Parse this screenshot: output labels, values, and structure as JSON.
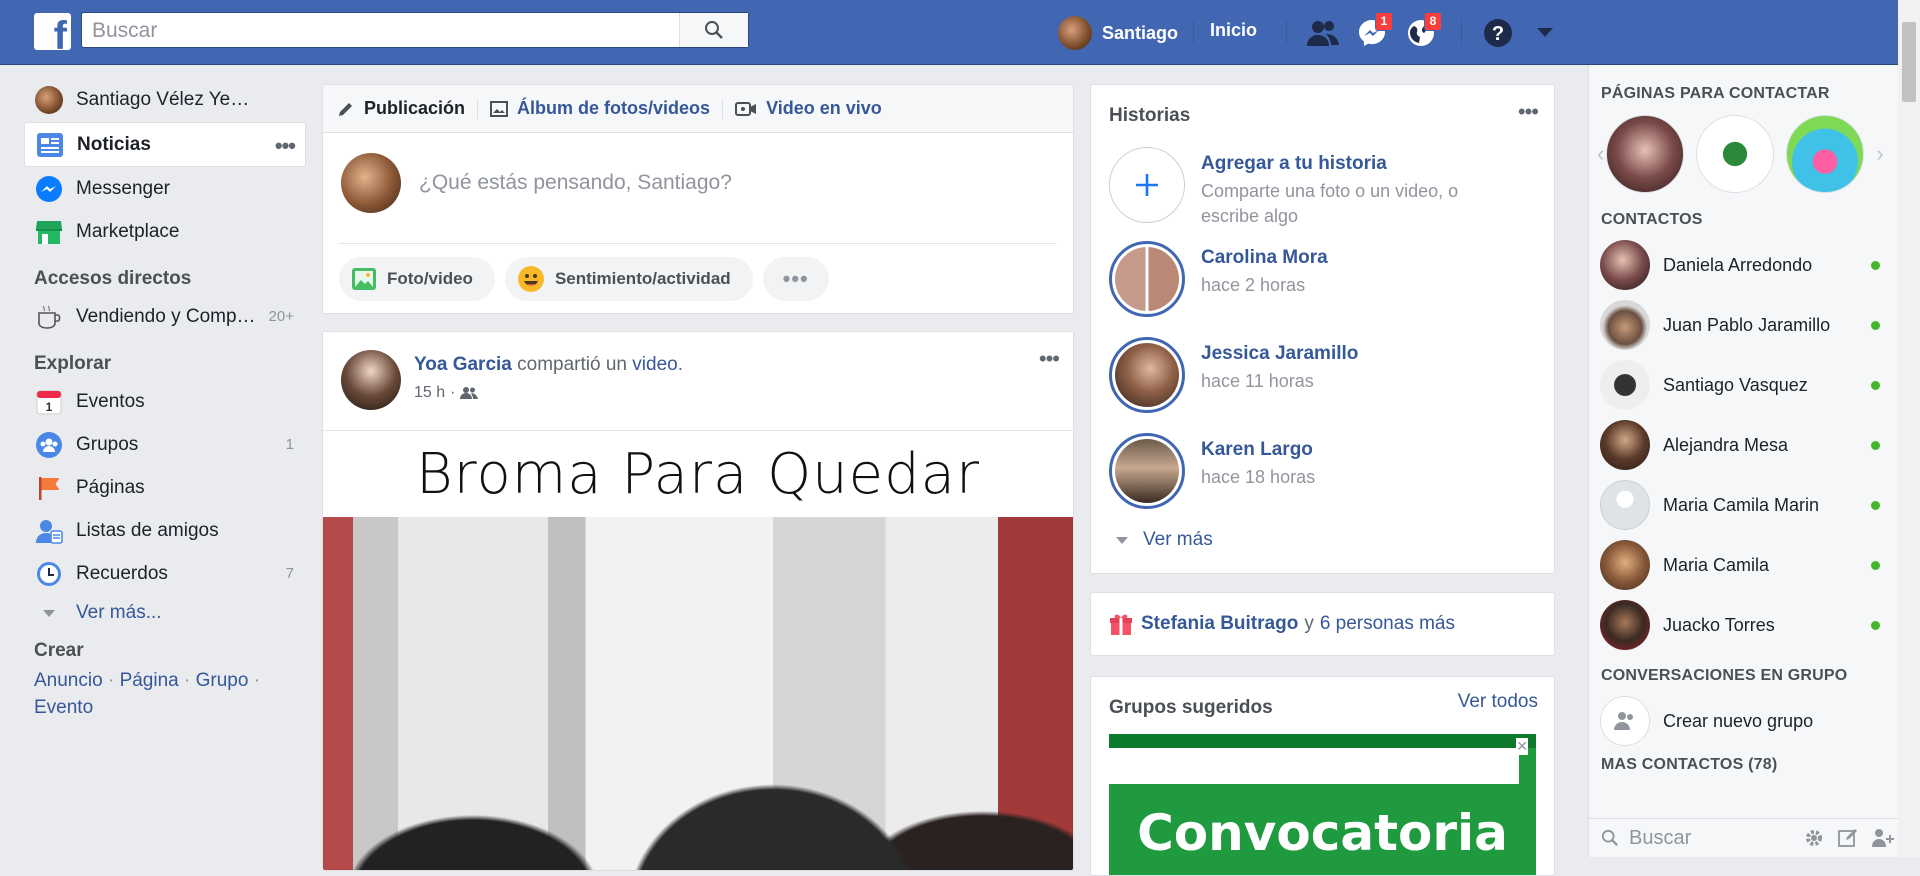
{
  "header": {
    "logo": "f",
    "search_placeholder": "Buscar",
    "user_name": "Santiago",
    "home_label": "Inicio",
    "messages_badge": "1",
    "notifications_badge": "8"
  },
  "left_nav": {
    "profile_name": "Santiago Vélez Ye…",
    "main_items": [
      {
        "label": "Noticias"
      },
      {
        "label": "Messenger"
      },
      {
        "label": "Marketplace"
      }
    ],
    "shortcuts_title": "Accesos directos",
    "shortcut": {
      "label": "Vendiendo y Comp…",
      "count": "20+"
    },
    "explore_title": "Explorar",
    "explore_items": [
      {
        "label": "Eventos",
        "count": ""
      },
      {
        "label": "Grupos",
        "count": "1"
      },
      {
        "label": "Páginas",
        "count": ""
      },
      {
        "label": "Listas de amigos",
        "count": ""
      },
      {
        "label": "Recuerdos",
        "count": "7"
      }
    ],
    "see_more": "Ver más...",
    "create_title": "Crear",
    "create_links": [
      "Anuncio",
      "Página",
      "Grupo",
      "Evento"
    ]
  },
  "composer": {
    "tabs": [
      "Publicación",
      "Álbum de fotos/videos",
      "Video en vivo"
    ],
    "placeholder": "¿Qué estás pensando, Santiago?",
    "actions": [
      "Foto/video",
      "Sentimiento/actividad"
    ]
  },
  "post": {
    "author": "Yoa Garcia",
    "action_pre": "compartió un",
    "action_link": "video",
    "time": "15 h",
    "video_title": "Broma Para Quedar"
  },
  "stories": {
    "title": "Historias",
    "add_title": "Agregar a tu historia",
    "add_sub": "Comparte una foto o un video, o escribe algo",
    "items": [
      {
        "name": "Carolina Mora",
        "time": "hace 2 horas"
      },
      {
        "name": "Jessica Jaramillo",
        "time": "hace 11 horas"
      },
      {
        "name": "Karen Largo",
        "time": "hace 18 horas"
      }
    ],
    "see_more": "Ver más"
  },
  "birthday": {
    "name": "Stefania Buitrago",
    "connector": "y",
    "others": "6 personas más"
  },
  "groups": {
    "title": "Grupos sugeridos",
    "see_all": "Ver todos",
    "banner_text": "Convocatoria"
  },
  "chat": {
    "pages_title": "PÁGINAS PARA CONTACTAR",
    "contacts_title": "CONTACTOS",
    "contacts": [
      {
        "name": "Daniela Arredondo"
      },
      {
        "name": "Juan Pablo Jaramillo"
      },
      {
        "name": "Santiago Vasquez"
      },
      {
        "name": "Alejandra Mesa"
      },
      {
        "name": "Maria Camila Marin"
      },
      {
        "name": "Maria Camila"
      },
      {
        "name": "Juacko Torres"
      }
    ],
    "group_title": "CONVERSACIONES EN GRUPO",
    "new_group": "Crear nuevo grupo",
    "more_contacts": "MÁS CONTACTOS (78)",
    "search_placeholder": "Buscar"
  },
  "colors": {
    "brand": "#4267b2",
    "link": "#365899",
    "online": "#42b72a",
    "badge": "#fa3e3e"
  }
}
